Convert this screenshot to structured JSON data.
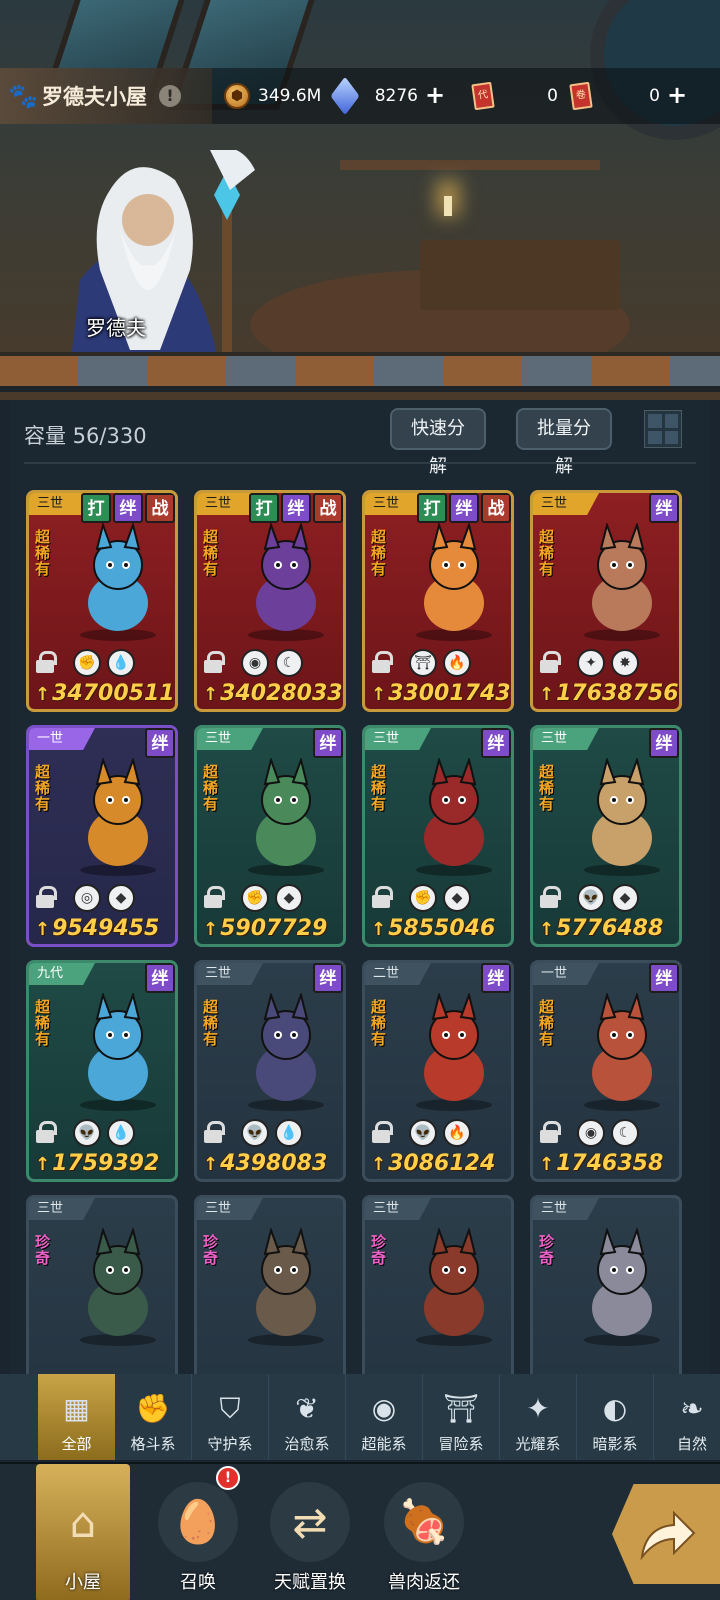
{
  "header": {
    "title": "罗德夫小屋",
    "info_glyph": "!",
    "npc_name": "罗德夫"
  },
  "resources": [
    {
      "icon": "gold-coin-icon",
      "value": "349.6M",
      "has_plus": false
    },
    {
      "icon": "crystal-gem-icon",
      "value": "8276",
      "has_plus": true
    },
    {
      "icon": "red-ticket-icon",
      "value": "0",
      "has_plus": false
    },
    {
      "icon": "scroll-ticket-icon",
      "value": "0",
      "has_plus": true
    }
  ],
  "inventory": {
    "capacity_label": "容量 56/330",
    "quick_decompose": "快速分解",
    "batch_decompose": "批量分解"
  },
  "cards": [
    {
      "gen": "三世",
      "tags": [
        "打",
        "绊",
        "战"
      ],
      "rarity": "超稀有",
      "power": "34700511",
      "frame": "red",
      "traits": [
        "fist",
        "drop"
      ]
    },
    {
      "gen": "三世",
      "tags": [
        "打",
        "绊",
        "战"
      ],
      "rarity": "超稀有",
      "power": "34028033",
      "frame": "red",
      "traits": [
        "eye",
        "moon"
      ]
    },
    {
      "gen": "三世",
      "tags": [
        "打",
        "绊",
        "战"
      ],
      "rarity": "超稀有",
      "power": "33001743",
      "frame": "red",
      "traits": [
        "shrine",
        "fire"
      ]
    },
    {
      "gen": "三世",
      "tags": [
        "绊"
      ],
      "rarity": "超稀有",
      "power": "17638756",
      "frame": "red",
      "traits": [
        "star4",
        "sun"
      ]
    },
    {
      "gen": "一世",
      "tags": [
        "绊"
      ],
      "rarity": "超稀有",
      "power": "9549455",
      "frame": "purple",
      "traits": [
        "swirl",
        "rock"
      ]
    },
    {
      "gen": "三世",
      "tags": [
        "绊"
      ],
      "rarity": "超稀有",
      "power": "5907729",
      "frame": "green",
      "traits": [
        "fist",
        "rock"
      ]
    },
    {
      "gen": "三世",
      "tags": [
        "绊"
      ],
      "rarity": "超稀有",
      "power": "5855046",
      "frame": "green",
      "traits": [
        "fist",
        "rock"
      ]
    },
    {
      "gen": "三世",
      "tags": [
        "绊"
      ],
      "rarity": "超稀有",
      "power": "5776488",
      "frame": "green",
      "traits": [
        "alien",
        "rock"
      ]
    },
    {
      "gen": "九代",
      "tags": [
        "绊"
      ],
      "rarity": "超稀有",
      "power": "1759392",
      "frame": "green",
      "traits": [
        "alien",
        "drop"
      ]
    },
    {
      "gen": "三世",
      "tags": [
        "绊"
      ],
      "rarity": "超稀有",
      "power": "4398083",
      "frame": "grey",
      "traits": [
        "alien",
        "drop"
      ]
    },
    {
      "gen": "二世",
      "tags": [
        "绊"
      ],
      "rarity": "超稀有",
      "power": "3086124",
      "frame": "grey",
      "traits": [
        "alien",
        "fire"
      ]
    },
    {
      "gen": "一世",
      "tags": [
        "绊"
      ],
      "rarity": "超稀有",
      "power": "1746358",
      "frame": "grey",
      "traits": [
        "eye",
        "moon"
      ]
    },
    {
      "gen": "三世",
      "tags": [],
      "rarity": "珍奇",
      "power": "",
      "frame": "grey",
      "traits": []
    },
    {
      "gen": "三世",
      "tags": [],
      "rarity": "珍奇",
      "power": "",
      "frame": "grey",
      "traits": []
    },
    {
      "gen": "三世",
      "tags": [],
      "rarity": "珍奇",
      "power": "",
      "frame": "grey",
      "traits": []
    },
    {
      "gen": "三世",
      "tags": [],
      "rarity": "珍奇",
      "power": "",
      "frame": "grey",
      "traits": []
    }
  ],
  "categories": [
    {
      "label": "全部",
      "icon": "blocks-icon",
      "active": true
    },
    {
      "label": "格斗系",
      "icon": "fist-icon",
      "active": false
    },
    {
      "label": "守护系",
      "icon": "shield-icon",
      "active": false
    },
    {
      "label": "治愈系",
      "icon": "sprout-icon",
      "active": false
    },
    {
      "label": "超能系",
      "icon": "alien-icon",
      "active": false
    },
    {
      "label": "冒险系",
      "icon": "shrine-icon",
      "active": false
    },
    {
      "label": "光耀系",
      "icon": "star-cross-icon",
      "active": false
    },
    {
      "label": "暗影系",
      "icon": "shadow-eye-icon",
      "active": false
    },
    {
      "label": "自然",
      "icon": "leaf-icon",
      "active": false
    }
  ],
  "bottom_nav": [
    {
      "label": "小屋",
      "icon": "house-icon",
      "active": true,
      "badge": ""
    },
    {
      "label": "召唤",
      "icon": "egg-icon",
      "active": false,
      "badge": "!"
    },
    {
      "label": "天赋置换",
      "icon": "swap-icon",
      "active": false,
      "badge": ""
    },
    {
      "label": "兽肉返还",
      "icon": "meat-icon",
      "active": false,
      "badge": ""
    }
  ],
  "colors": {
    "power_text": "#ffcf4a",
    "super_rare": "#f5a623",
    "rare": "#f060c8",
    "active_tab": "#c9a447"
  }
}
